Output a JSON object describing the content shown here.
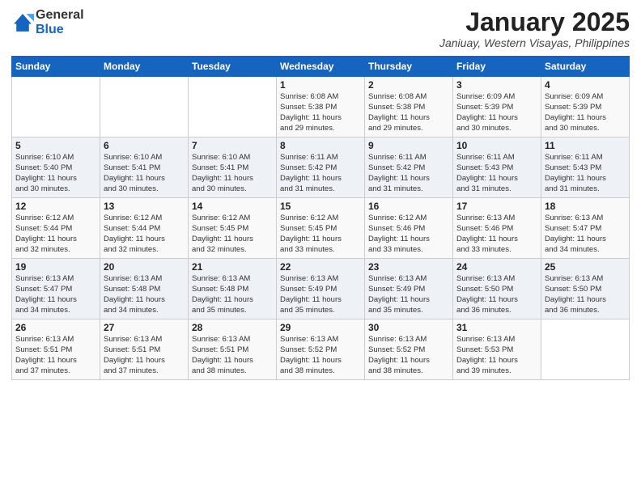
{
  "logo": {
    "general": "General",
    "blue": "Blue"
  },
  "header": {
    "title": "January 2025",
    "subtitle": "Janiuay, Western Visayas, Philippines"
  },
  "weekdays": [
    "Sunday",
    "Monday",
    "Tuesday",
    "Wednesday",
    "Thursday",
    "Friday",
    "Saturday"
  ],
  "weeks": [
    [
      {
        "day": "",
        "info": ""
      },
      {
        "day": "",
        "info": ""
      },
      {
        "day": "",
        "info": ""
      },
      {
        "day": "1",
        "info": "Sunrise: 6:08 AM\nSunset: 5:38 PM\nDaylight: 11 hours\nand 29 minutes."
      },
      {
        "day": "2",
        "info": "Sunrise: 6:08 AM\nSunset: 5:38 PM\nDaylight: 11 hours\nand 29 minutes."
      },
      {
        "day": "3",
        "info": "Sunrise: 6:09 AM\nSunset: 5:39 PM\nDaylight: 11 hours\nand 30 minutes."
      },
      {
        "day": "4",
        "info": "Sunrise: 6:09 AM\nSunset: 5:39 PM\nDaylight: 11 hours\nand 30 minutes."
      }
    ],
    [
      {
        "day": "5",
        "info": "Sunrise: 6:10 AM\nSunset: 5:40 PM\nDaylight: 11 hours\nand 30 minutes."
      },
      {
        "day": "6",
        "info": "Sunrise: 6:10 AM\nSunset: 5:41 PM\nDaylight: 11 hours\nand 30 minutes."
      },
      {
        "day": "7",
        "info": "Sunrise: 6:10 AM\nSunset: 5:41 PM\nDaylight: 11 hours\nand 30 minutes."
      },
      {
        "day": "8",
        "info": "Sunrise: 6:11 AM\nSunset: 5:42 PM\nDaylight: 11 hours\nand 31 minutes."
      },
      {
        "day": "9",
        "info": "Sunrise: 6:11 AM\nSunset: 5:42 PM\nDaylight: 11 hours\nand 31 minutes."
      },
      {
        "day": "10",
        "info": "Sunrise: 6:11 AM\nSunset: 5:43 PM\nDaylight: 11 hours\nand 31 minutes."
      },
      {
        "day": "11",
        "info": "Sunrise: 6:11 AM\nSunset: 5:43 PM\nDaylight: 11 hours\nand 31 minutes."
      }
    ],
    [
      {
        "day": "12",
        "info": "Sunrise: 6:12 AM\nSunset: 5:44 PM\nDaylight: 11 hours\nand 32 minutes."
      },
      {
        "day": "13",
        "info": "Sunrise: 6:12 AM\nSunset: 5:44 PM\nDaylight: 11 hours\nand 32 minutes."
      },
      {
        "day": "14",
        "info": "Sunrise: 6:12 AM\nSunset: 5:45 PM\nDaylight: 11 hours\nand 32 minutes."
      },
      {
        "day": "15",
        "info": "Sunrise: 6:12 AM\nSunset: 5:45 PM\nDaylight: 11 hours\nand 33 minutes."
      },
      {
        "day": "16",
        "info": "Sunrise: 6:12 AM\nSunset: 5:46 PM\nDaylight: 11 hours\nand 33 minutes."
      },
      {
        "day": "17",
        "info": "Sunrise: 6:13 AM\nSunset: 5:46 PM\nDaylight: 11 hours\nand 33 minutes."
      },
      {
        "day": "18",
        "info": "Sunrise: 6:13 AM\nSunset: 5:47 PM\nDaylight: 11 hours\nand 34 minutes."
      }
    ],
    [
      {
        "day": "19",
        "info": "Sunrise: 6:13 AM\nSunset: 5:47 PM\nDaylight: 11 hours\nand 34 minutes."
      },
      {
        "day": "20",
        "info": "Sunrise: 6:13 AM\nSunset: 5:48 PM\nDaylight: 11 hours\nand 34 minutes."
      },
      {
        "day": "21",
        "info": "Sunrise: 6:13 AM\nSunset: 5:48 PM\nDaylight: 11 hours\nand 35 minutes."
      },
      {
        "day": "22",
        "info": "Sunrise: 6:13 AM\nSunset: 5:49 PM\nDaylight: 11 hours\nand 35 minutes."
      },
      {
        "day": "23",
        "info": "Sunrise: 6:13 AM\nSunset: 5:49 PM\nDaylight: 11 hours\nand 35 minutes."
      },
      {
        "day": "24",
        "info": "Sunrise: 6:13 AM\nSunset: 5:50 PM\nDaylight: 11 hours\nand 36 minutes."
      },
      {
        "day": "25",
        "info": "Sunrise: 6:13 AM\nSunset: 5:50 PM\nDaylight: 11 hours\nand 36 minutes."
      }
    ],
    [
      {
        "day": "26",
        "info": "Sunrise: 6:13 AM\nSunset: 5:51 PM\nDaylight: 11 hours\nand 37 minutes."
      },
      {
        "day": "27",
        "info": "Sunrise: 6:13 AM\nSunset: 5:51 PM\nDaylight: 11 hours\nand 37 minutes."
      },
      {
        "day": "28",
        "info": "Sunrise: 6:13 AM\nSunset: 5:51 PM\nDaylight: 11 hours\nand 38 minutes."
      },
      {
        "day": "29",
        "info": "Sunrise: 6:13 AM\nSunset: 5:52 PM\nDaylight: 11 hours\nand 38 minutes."
      },
      {
        "day": "30",
        "info": "Sunrise: 6:13 AM\nSunset: 5:52 PM\nDaylight: 11 hours\nand 38 minutes."
      },
      {
        "day": "31",
        "info": "Sunrise: 6:13 AM\nSunset: 5:53 PM\nDaylight: 11 hours\nand 39 minutes."
      },
      {
        "day": "",
        "info": ""
      }
    ]
  ]
}
